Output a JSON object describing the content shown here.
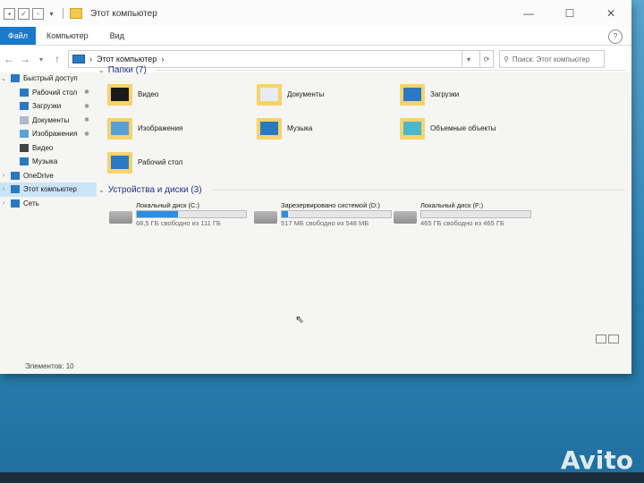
{
  "window": {
    "title": "Этот компьютер",
    "controls": {
      "minimize": "—",
      "maximize": "☐",
      "close": "✕"
    }
  },
  "ribbon": {
    "tabs": [
      "Файл",
      "Компьютер",
      "Вид"
    ],
    "help": "?"
  },
  "navigation": {
    "back": "←",
    "forward": "→",
    "recent": "▾",
    "up": "↑",
    "address": "Этот компьютер",
    "address_chevron": "›",
    "dropdown": "▾",
    "refresh": "⟳",
    "search_placeholder": "Поиск: Этот компьютер",
    "search_icon": "search-icon"
  },
  "sidebar": {
    "items": [
      {
        "label": "Быстрый доступ",
        "icon": "star-icon",
        "pinned": false
      },
      {
        "label": "Рабочий стол",
        "icon": "desktop-icon",
        "pinned": true
      },
      {
        "label": "Загрузки",
        "icon": "download-icon",
        "pinned": true
      },
      {
        "label": "Документы",
        "icon": "documents-icon",
        "pinned": true
      },
      {
        "label": "Изображения",
        "icon": "pictures-icon",
        "pinned": true
      },
      {
        "label": "Видео",
        "icon": "video-icon",
        "pinned": false
      },
      {
        "label": "Музыка",
        "icon": "music-icon",
        "pinned": false
      },
      {
        "label": "OneDrive",
        "icon": "cloud-icon",
        "pinned": false
      },
      {
        "label": "Этот компьютер",
        "icon": "computer-icon",
        "pinned": false,
        "active": true
      },
      {
        "label": "Сеть",
        "icon": "network-icon",
        "pinned": false
      }
    ]
  },
  "folders_section": {
    "title": "Папки (7)",
    "items": [
      {
        "label": "Видео",
        "icon": "video-folder-icon"
      },
      {
        "label": "Документы",
        "icon": "documents-folder-icon"
      },
      {
        "label": "Загрузки",
        "icon": "downloads-folder-icon"
      },
      {
        "label": "Изображения",
        "icon": "pictures-folder-icon"
      },
      {
        "label": "Музыка",
        "icon": "music-folder-icon"
      },
      {
        "label": "Объемные объекты",
        "icon": "3d-objects-folder-icon"
      },
      {
        "label": "Рабочий стол",
        "icon": "desktop-folder-icon"
      }
    ]
  },
  "drives_section": {
    "title": "Устройства и диски (3)",
    "items": [
      {
        "label": "Локальный диск (C:)",
        "free": "68,5 ГБ свободно из 111 ГБ",
        "used_fraction": 0.38,
        "icon": "windows-drive-icon"
      },
      {
        "label": "Зарезервировано системой (D:)",
        "free": "517 МБ свободно из 548 МБ",
        "used_fraction": 0.06,
        "icon": "drive-icon"
      },
      {
        "label": "Локальный диск (F:)",
        "free": "465 ГБ свободно из 465 ГБ",
        "used_fraction": 0.0,
        "icon": "drive-icon"
      }
    ]
  },
  "statusbar": {
    "text": "Элементов: 10"
  },
  "colors": {
    "accent": "#1979ca",
    "drive_bar": "#2d8de0",
    "folder": "#f6d36b",
    "section_title": "#1e3287"
  },
  "watermark": {
    "text": "Avito"
  }
}
